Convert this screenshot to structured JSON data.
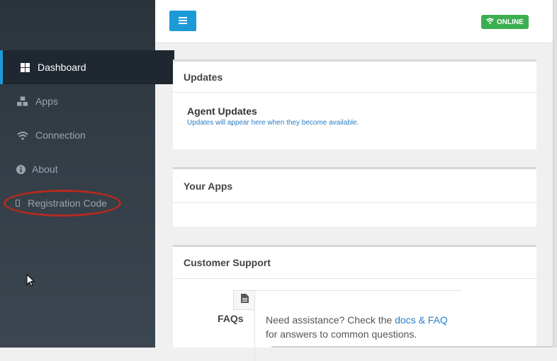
{
  "sidebar": {
    "items": [
      {
        "label": "Dashboard",
        "icon": "dashboard-icon",
        "active": true
      },
      {
        "label": "Apps",
        "icon": "cubes-icon",
        "active": false
      },
      {
        "label": "Connection",
        "icon": "wifi-icon",
        "active": false
      },
      {
        "label": "About",
        "icon": "info-icon",
        "active": false
      },
      {
        "label": "Registration Code",
        "icon": "mobile-icon",
        "active": false
      }
    ],
    "accent_color": "#1c9ad6",
    "annotation_color": "#b52a1f"
  },
  "topbar": {
    "menu_icon": "hamburger-icon",
    "status": {
      "label": "ONLINE",
      "icon": "wifi-icon",
      "color": "#3cae52"
    }
  },
  "panels": {
    "updates": {
      "title": "Updates",
      "agent_title": "Agent Updates",
      "agent_subtitle": "Updates will appear here when they become available."
    },
    "apps": {
      "title": "Your Apps"
    },
    "support": {
      "title": "Customer Support",
      "faq_label": "FAQs",
      "faq_text_before": "Need assistance? Check the ",
      "faq_link": "docs & FAQ",
      "faq_text_after": "for answers to common questions.",
      "faq_icon": "document-icon"
    }
  }
}
